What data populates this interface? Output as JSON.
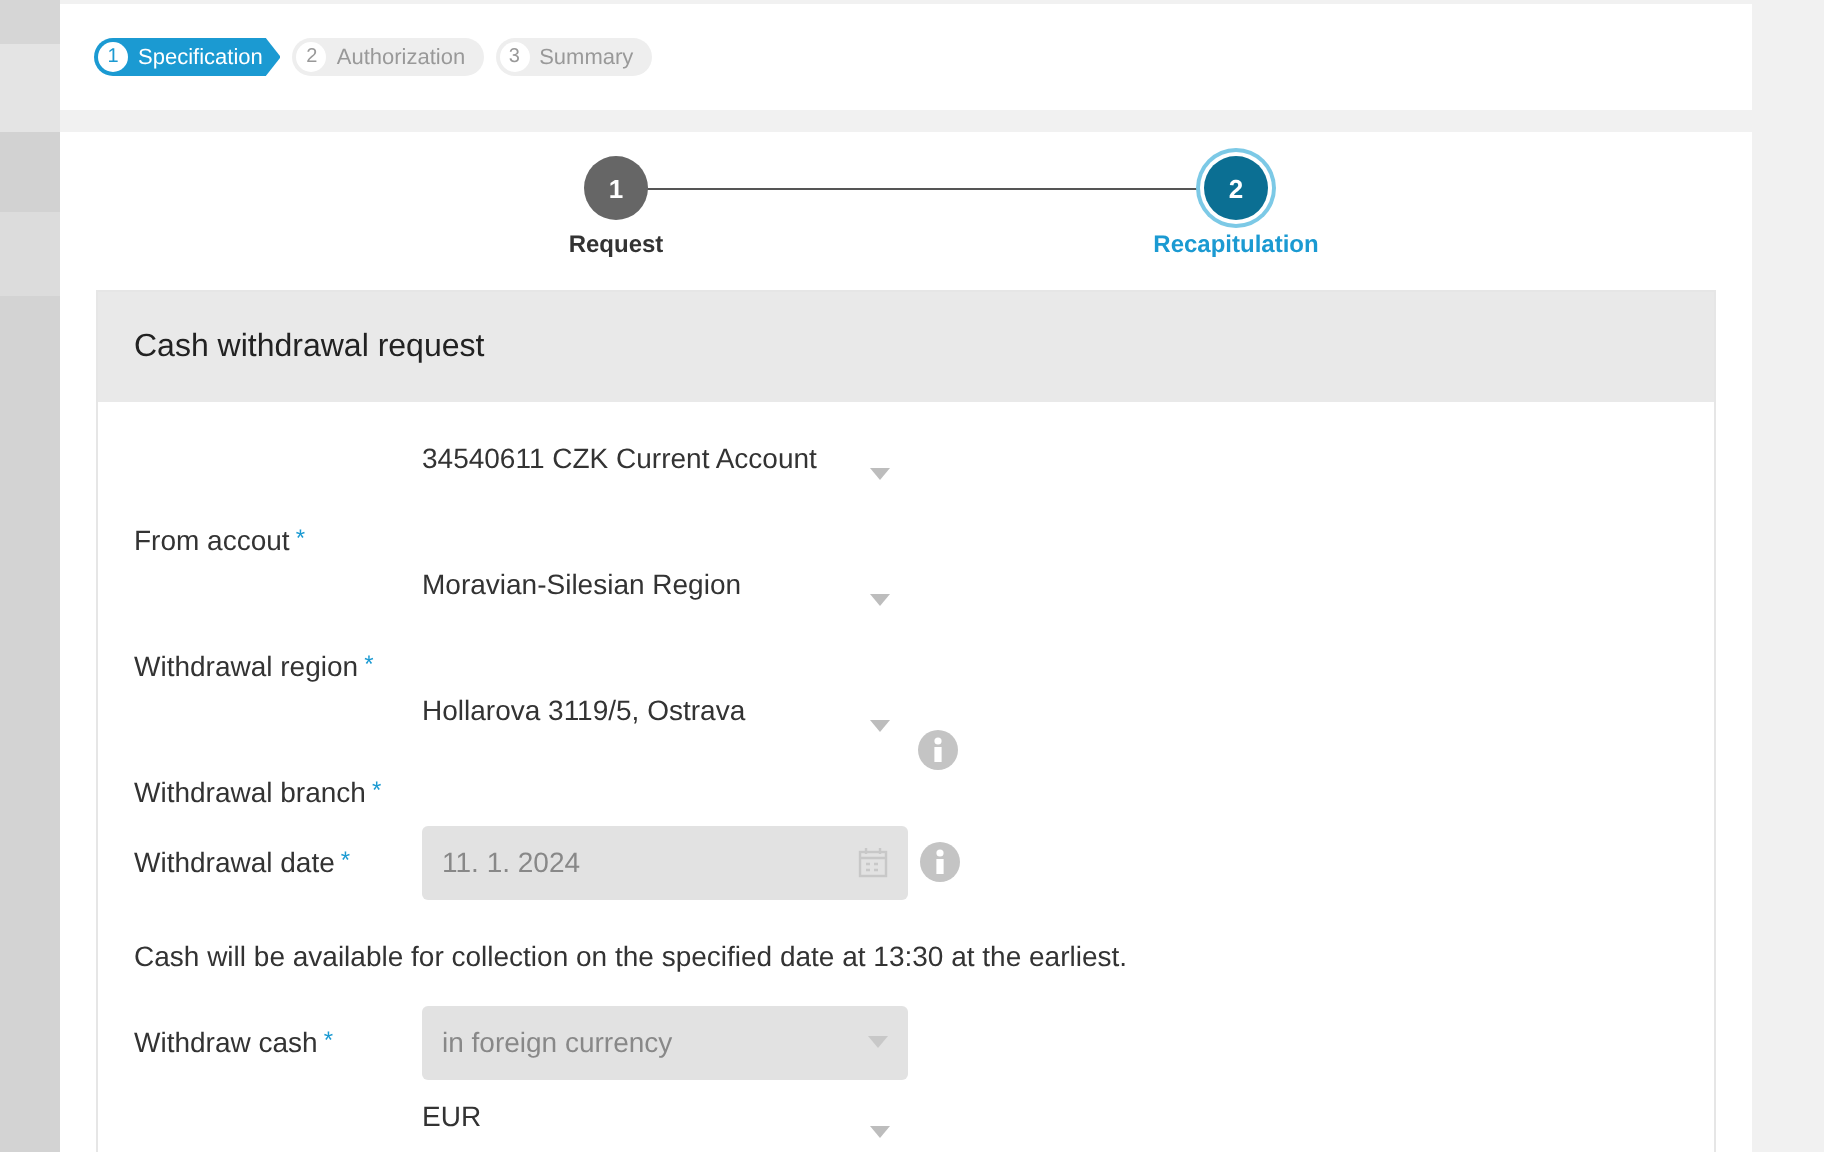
{
  "breadcrumb": [
    {
      "number": "1",
      "label": "Specification",
      "selected": true
    },
    {
      "number": "2",
      "label": "Authorization",
      "selected": false
    },
    {
      "number": "3",
      "label": "Summary",
      "selected": false
    }
  ],
  "progress": [
    {
      "number": "1",
      "label": "Request",
      "selected": false
    },
    {
      "number": "2",
      "label": "Recapitulation",
      "selected": true
    }
  ],
  "form": {
    "title": "Cash withdrawal request",
    "fields": [
      {
        "kind": "select",
        "label": "From accout",
        "required_mark": "*",
        "value": "34540611 CZK Current Account",
        "info": false
      },
      {
        "kind": "select",
        "label": "Withdrawal region",
        "required_mark": "*",
        "value": "Moravian-Silesian Region",
        "info": false
      },
      {
        "kind": "select",
        "label": "Withdrawal branch",
        "required_mark": "*",
        "value": "Hollarova 3119/5, Ostrava",
        "info": true
      },
      {
        "kind": "date",
        "label": "Withdrawal date",
        "required_mark": "*",
        "value": "11. 1. 2024",
        "info": true
      },
      {
        "kind": "note",
        "label": "Cash will be available for collection on the specified date at 13:30 at the earliest."
      },
      {
        "kind": "disabled-select",
        "label": "Withdraw cash",
        "required_mark": "*",
        "value": "in foreign currency",
        "info": false
      },
      {
        "kind": "select",
        "value": "EUR",
        "info": false
      }
    ]
  }
}
